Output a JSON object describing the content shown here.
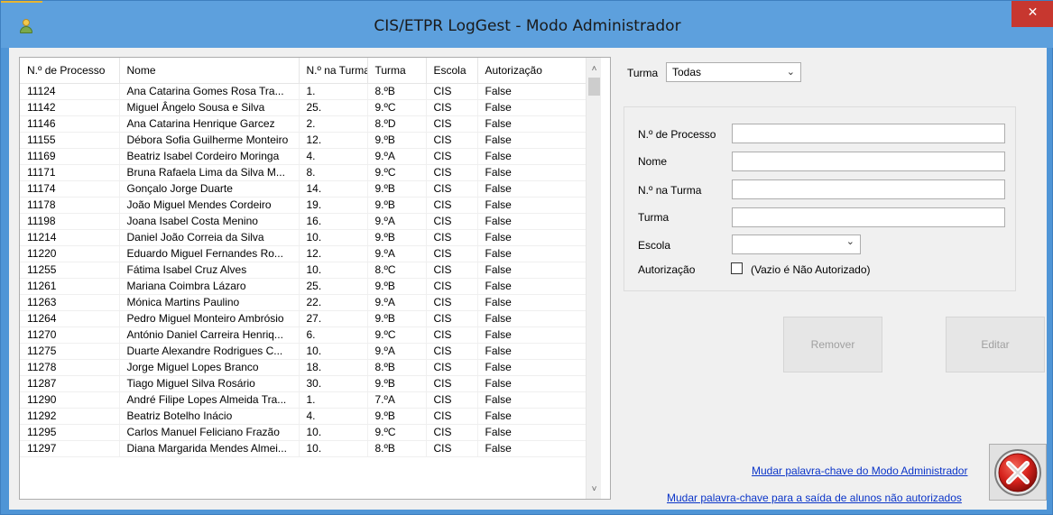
{
  "window": {
    "title": "CIS/ETPR LogGest - Modo Administrador",
    "close_glyph": "✕"
  },
  "grid": {
    "columns": [
      "N.º de Processo",
      "Nome",
      "N.º na Turma",
      "Turma",
      "Escola",
      "Autorização"
    ],
    "rows": [
      [
        "11124",
        "Ana Catarina Gomes Rosa Tra...",
        "1.",
        "8.ºB",
        "CIS",
        "False"
      ],
      [
        "11142",
        "Miguel Ângelo Sousa e Silva",
        "25.",
        "9.ºC",
        "CIS",
        "False"
      ],
      [
        "11146",
        "Ana Catarina Henrique Garcez",
        "2.",
        "8.ºD",
        "CIS",
        "False"
      ],
      [
        "11155",
        "Débora Sofia Guilherme Monteiro",
        "12.",
        "9.ºB",
        "CIS",
        "False"
      ],
      [
        "11169",
        "Beatriz Isabel Cordeiro Moringa",
        "4.",
        "9.ºA",
        "CIS",
        "False"
      ],
      [
        "11171",
        "Bruna Rafaela Lima da Silva M...",
        "8.",
        "9.ºC",
        "CIS",
        "False"
      ],
      [
        "11174",
        "Gonçalo Jorge Duarte",
        "14.",
        "9.ºB",
        "CIS",
        "False"
      ],
      [
        "11178",
        "João Miguel Mendes Cordeiro",
        "19.",
        "9.ºB",
        "CIS",
        "False"
      ],
      [
        "11198",
        "Joana Isabel Costa Menino",
        "16.",
        "9.ºA",
        "CIS",
        "False"
      ],
      [
        "11214",
        "Daniel João Correia da Silva",
        "10.",
        "9.ºB",
        "CIS",
        "False"
      ],
      [
        "11220",
        "Eduardo Miguel Fernandes Ro...",
        "12.",
        "9.ºA",
        "CIS",
        "False"
      ],
      [
        "11255",
        "Fátima Isabel Cruz Alves",
        "10.",
        "8.ºC",
        "CIS",
        "False"
      ],
      [
        "11261",
        "Mariana Coimbra Lázaro",
        "25.",
        "9.ºB",
        "CIS",
        "False"
      ],
      [
        "11263",
        "Mónica Martins Paulino",
        "22.",
        "9.ºA",
        "CIS",
        "False"
      ],
      [
        "11264",
        "Pedro Miguel Monteiro Ambrósio",
        "27.",
        "9.ºB",
        "CIS",
        "False"
      ],
      [
        "11270",
        "António Daniel Carreira Henriq...",
        "6.",
        "9.ºC",
        "CIS",
        "False"
      ],
      [
        "11275",
        "Duarte Alexandre Rodrigues C...",
        "10.",
        "9.ºA",
        "CIS",
        "False"
      ],
      [
        "11278",
        "Jorge Miguel Lopes Branco",
        "18.",
        "8.ºB",
        "CIS",
        "False"
      ],
      [
        "11287",
        "Tiago Miguel Silva Rosário",
        "30.",
        "9.ºB",
        "CIS",
        "False"
      ],
      [
        "11290",
        "André Filipe Lopes Almeida Tra...",
        "1.",
        "7.ºA",
        "CIS",
        "False"
      ],
      [
        "11292",
        "Beatriz Botelho Inácio",
        "4.",
        "9.ºB",
        "CIS",
        "False"
      ],
      [
        "11295",
        "Carlos Manuel Feliciano Frazão",
        "10.",
        "9.ºC",
        "CIS",
        "False"
      ],
      [
        "11297",
        "Diana Margarida Mendes Almei...",
        "10.",
        "8.ºB",
        "CIS",
        "False"
      ]
    ],
    "scroll_up_glyph": "˄",
    "scroll_down_glyph": "˅"
  },
  "filter": {
    "turma_label": "Turma",
    "turma_value": "Todas",
    "chevron_glyph": "⌄"
  },
  "form": {
    "processo_label": "N.º de Processo",
    "nome_label": "Nome",
    "n_turma_label": "N.º na Turma",
    "turma_label": "Turma",
    "escola_label": "Escola",
    "autorizacao_label": "Autorização",
    "autorizacao_hint": "(Vazio é Não Autorizado)"
  },
  "actions": {
    "remover_label": "Remover",
    "editar_label": "Editar",
    "link_admin_password": "Mudar palavra-chave do Modo Administrador",
    "link_exit_password": "Mudar palavra-chave para a saída de alunos não autorizados"
  },
  "icons": {
    "app": "user-icon",
    "exit": "exit-x-icon"
  },
  "colors": {
    "title_bar": "#5da0dd",
    "close": "#c7372f",
    "link": "#0a34c8",
    "exit_red": "#d6221c"
  }
}
